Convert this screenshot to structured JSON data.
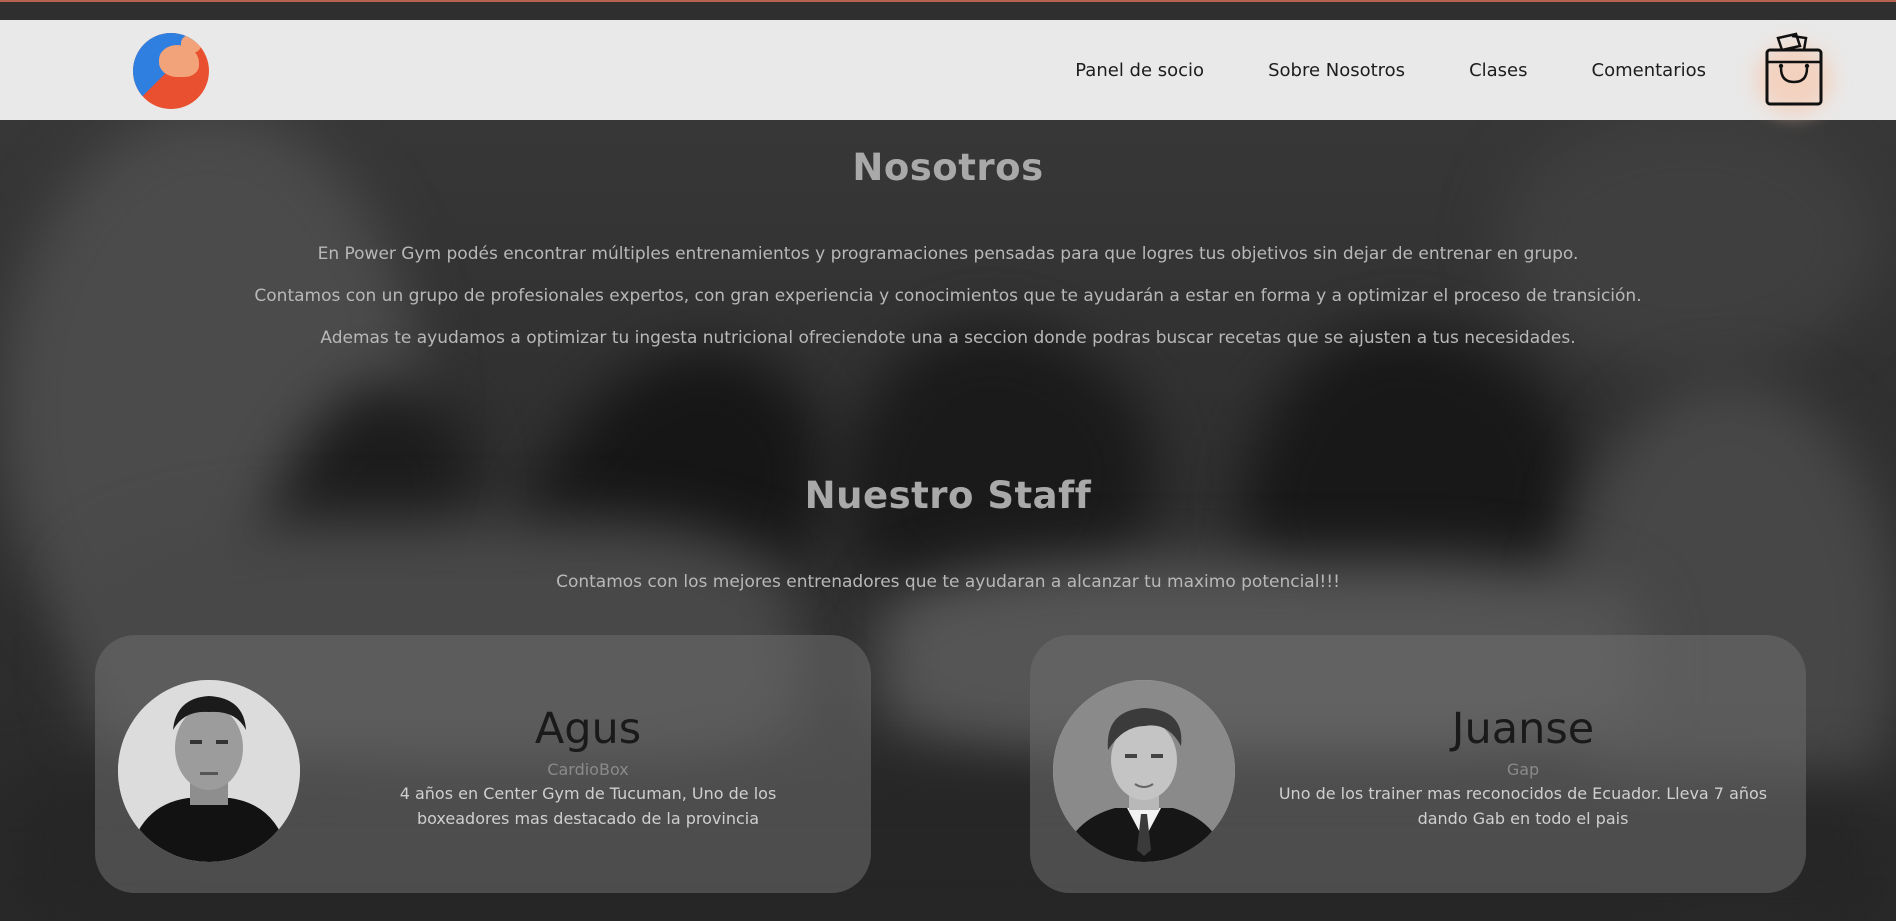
{
  "nav": {
    "links": [
      "Panel de socio",
      "Sobre Nosotros",
      "Clases",
      "Comentarios"
    ]
  },
  "about": {
    "title": "Nosotros",
    "paragraphs": [
      "En Power Gym podés encontrar múltiples entrenamientos y programaciones pensadas para que logres tus objetivos sin dejar de entrenar en grupo.",
      "Contamos con un grupo de profesionales expertos, con gran experiencia y conocimientos que te ayudarán a estar en forma y a optimizar el proceso de transición.",
      "Ademas te ayudamos a optimizar tu ingesta nutricional ofreciendote una a seccion donde podras buscar recetas que se ajusten a tus necesidades."
    ]
  },
  "staff": {
    "title": "Nuestro Staff",
    "subtitle": "Contamos con los mejores entrenadores que te ayudaran a alcanzar tu maximo potencial!!!",
    "members": [
      {
        "name": "Agus",
        "role": "CardioBox",
        "description": "4 años en Center Gym de Tucuman, Uno de los boxeadores mas destacado de la provincia"
      },
      {
        "name": "Juanse",
        "role": "Gap",
        "description": "Uno de los trainer mas reconocidos de Ecuador. Lleva 7 años dando Gab en todo el pais"
      }
    ]
  },
  "icons": {
    "logo": "flexed-arm-logo",
    "cart": "shopping-bag-icon"
  },
  "colors": {
    "navbar_bg": "#e9e9e9",
    "heading": "#a9a9a9",
    "accent": "#e9502f",
    "logo_blue": "#2f7fe0"
  }
}
